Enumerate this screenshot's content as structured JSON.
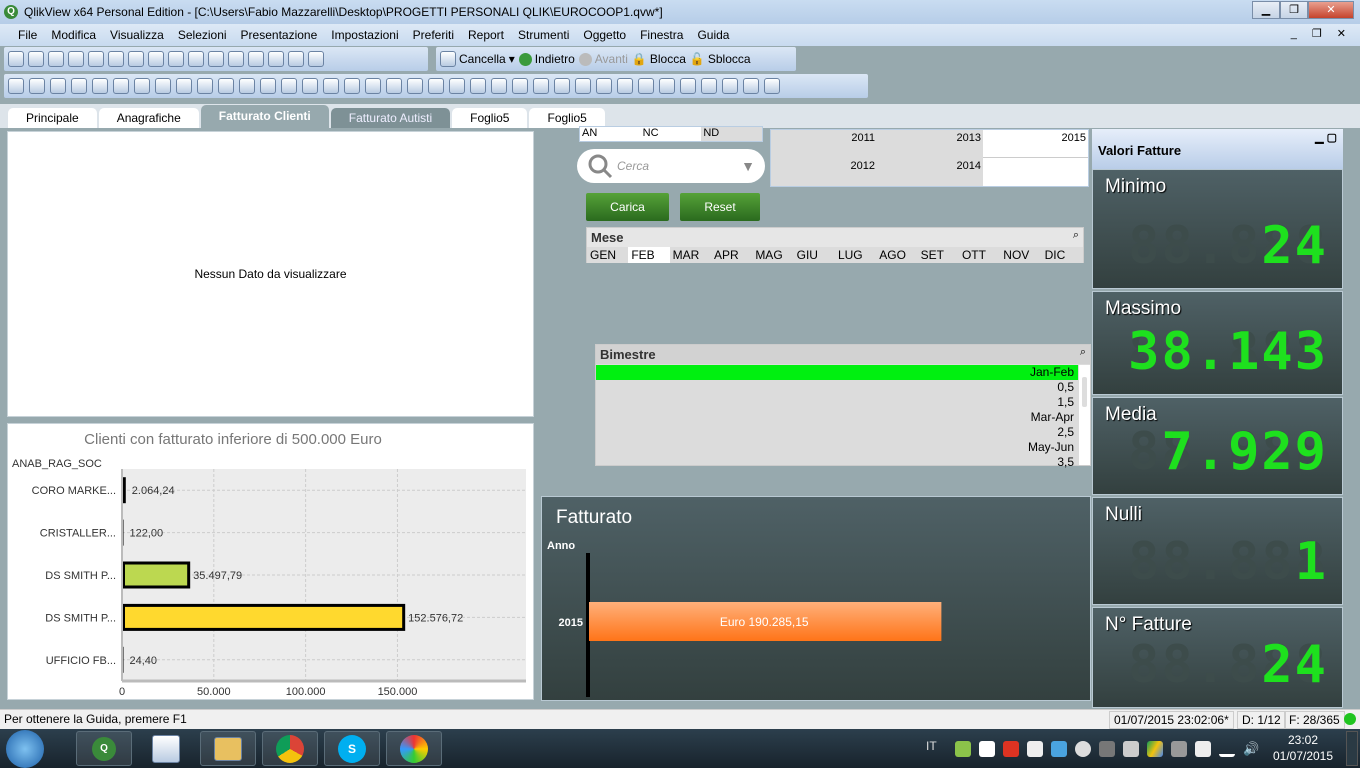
{
  "window": {
    "title": "QlikView x64 Personal Edition - [C:\\Users\\Fabio Mazzarelli\\Desktop\\PROGETTI PERSONALI QLIK\\EUROCOOP1.qvw*]",
    "min": "▁",
    "max": "❐",
    "close": "✕"
  },
  "menu": [
    "File",
    "Modifica",
    "Visualizza",
    "Selezioni",
    "Presentazione",
    "Impostazioni",
    "Preferiti",
    "Report",
    "Strumenti",
    "Oggetto",
    "Finestra",
    "Guida"
  ],
  "mdi_controls": "_ ❐ ✕",
  "toolbar": {
    "cancella": "Cancella",
    "indietro": "Indietro",
    "avanti": "Avanti",
    "blocca": "Blocca",
    "sblocca": "Sblocca"
  },
  "tabs": [
    {
      "label": "Principale"
    },
    {
      "label": "Anagrafiche"
    },
    {
      "label": "Fatturato Clienti",
      "active": true
    },
    {
      "label": "Fatturato Autisti"
    },
    {
      "label": "Foglio5"
    },
    {
      "label": "Foglio5"
    }
  ],
  "empty_chart": {
    "message": "Nessun Dato da visualizzare"
  },
  "type_list": [
    "AN",
    "NC",
    "ND"
  ],
  "search": {
    "placeholder": "Cerca"
  },
  "years": [
    "2011",
    "2013",
    "2015",
    "2012",
    "2014",
    ""
  ],
  "buttons": {
    "carica": "Carica",
    "reset": "Reset"
  },
  "mese": {
    "title": "Mese",
    "items": [
      "GEN",
      "FEB",
      "MAR",
      "APR",
      "MAG",
      "GIU",
      "LUG",
      "AGO",
      "SET",
      "OTT",
      "NOV",
      "DIC"
    ],
    "selected": "FEB"
  },
  "bimestre": {
    "title": "Bimestre",
    "items": [
      "Jan-Feb",
      "0,5",
      "1,5",
      "Mar-Apr",
      "2,5",
      "May-Jun",
      "3,5"
    ],
    "selected": "Jan-Feb",
    "selected_color": "#00f010"
  },
  "chart_data": [
    {
      "type": "bar",
      "orientation": "horizontal",
      "title": "Clienti con fatturato inferiore di 500.000 Euro",
      "ylabel": "ANAB_RAG_SOC",
      "categories": [
        "CORO MARKE...",
        "CRISTALLER...",
        "DS SMITH P...",
        "DS SMITH P...",
        "UFFICIO FB..."
      ],
      "values": [
        2064.24,
        122.0,
        35497.79,
        152576.72,
        24.4
      ],
      "labels": [
        "2.064,24",
        "122,00",
        "35.497,79",
        "152.576,72",
        "24,40"
      ],
      "colors": [
        "#000000",
        "#000000",
        "#bcd850",
        "#ffd92e",
        "#000000"
      ],
      "xticks": [
        "0",
        "50.000",
        "100.000",
        "150.000"
      ],
      "xtick_values": [
        0,
        50000,
        100000,
        150000
      ],
      "xlim": [
        0,
        220000
      ],
      "grid": true
    },
    {
      "type": "bar",
      "orientation": "horizontal",
      "title": "Fatturato",
      "ylabel": "Anno",
      "categories": [
        "2015"
      ],
      "values": [
        190285.15
      ],
      "labels": [
        "Euro 190.285,15"
      ],
      "colors": [
        "#ff8a3c"
      ],
      "xlim": [
        0,
        270000
      ]
    }
  ],
  "kpi_panel": {
    "title": "Valori Fatture",
    "items": [
      {
        "label": "Minimo",
        "value": "24"
      },
      {
        "label": "Massimo",
        "value": "38.143"
      },
      {
        "label": "Media",
        "value": "7.929"
      },
      {
        "label": "Nulli",
        "value": "1"
      },
      {
        "label": "N° Fatture",
        "value": "24"
      }
    ]
  },
  "status": {
    "help": "Per ottenere la Guida, premere F1",
    "timestamp": "01/07/2015 23:02:06*",
    "d": "D: 1/12",
    "f": "F: 28/365"
  },
  "taskbar": {
    "lang": "IT",
    "time": "23:02",
    "date": "01/07/2015"
  }
}
